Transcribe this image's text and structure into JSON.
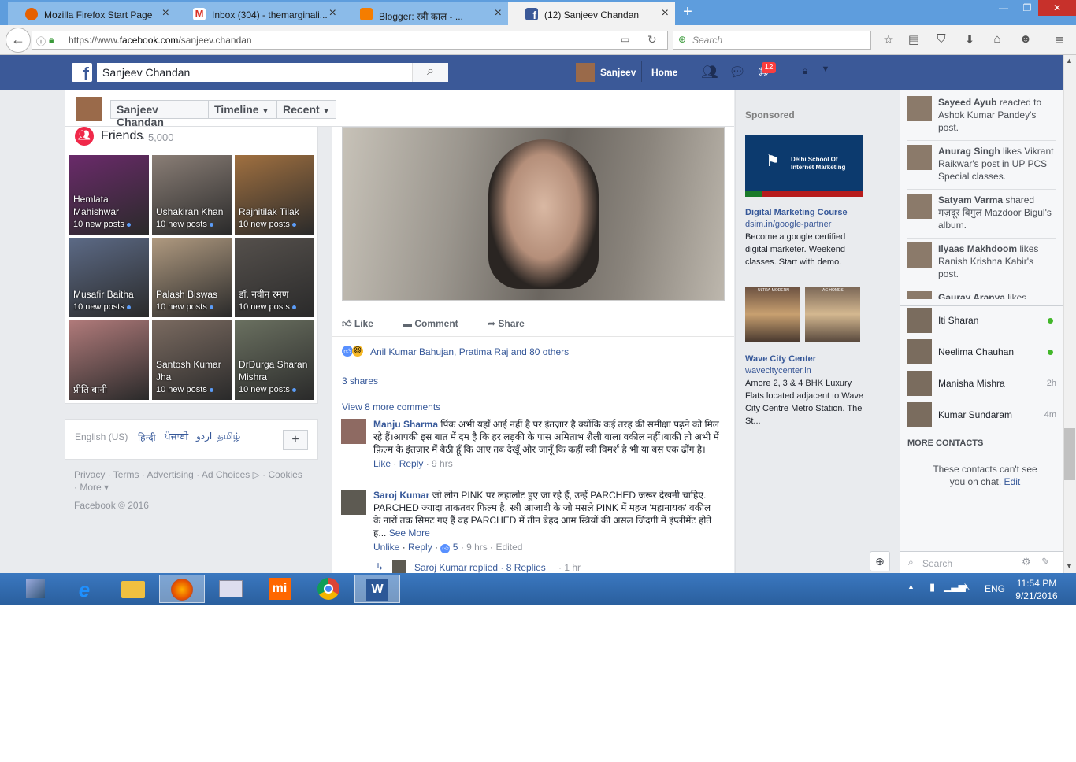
{
  "browser": {
    "tabs": [
      {
        "label": "Mozilla Firefox Start Page",
        "icon": "firefox-icon",
        "color": "#e66000"
      },
      {
        "label": "Inbox (304) - themarginali...",
        "icon": "gmail-icon",
        "color": "#d93025"
      },
      {
        "label": "Blogger: स्त्री काल - ...",
        "icon": "blogger-icon",
        "color": "#f57d00"
      },
      {
        "label": "(12) Sanjeev Chandan",
        "icon": "facebook-icon",
        "color": "#3b5998"
      }
    ],
    "url_prefix": "https://www.",
    "url_domain": "facebook.com",
    "url_path": "/sanjeev.chandan",
    "search_placeholder": "Search"
  },
  "fb": {
    "search_value": "Sanjeev Chandan",
    "user_name": "Sanjeev",
    "home_label": "Home",
    "notif_count": "12",
    "accent": "#3b5998"
  },
  "timeline_nav": {
    "name": "Sanjeev Chandan",
    "timeline": "Timeline",
    "recent": "Recent"
  },
  "friends": {
    "title": "Friends",
    "count": "5,000",
    "items": [
      {
        "name": "Hemlata Mahishwar",
        "posts": "10 new posts",
        "color": "#6a2a6a"
      },
      {
        "name": "Ushakiran Khan",
        "posts": "10 new posts",
        "color": "#8a7e76"
      },
      {
        "name": "Rajnitilak Tilak",
        "posts": "10 new posts",
        "color": "#a07040"
      },
      {
        "name": "Musafir Baitha",
        "posts": "10 new posts",
        "color": "#5c6a86"
      },
      {
        "name": "Palash Biswas",
        "posts": "10 new posts",
        "color": "#b09a80"
      },
      {
        "name": "डॉ. नवीन रमण",
        "posts": "10 new posts",
        "color": "#55504c"
      },
      {
        "name": "प्रीति बानी",
        "posts": "",
        "color": "#b07a7a"
      },
      {
        "name": "Santosh Kumar Jha",
        "posts": "10 new posts",
        "color": "#7a6a60"
      },
      {
        "name": "DrDurga Sharan Mishra",
        "posts": "10 new posts",
        "color": "#6a7060"
      }
    ]
  },
  "languages": {
    "items": [
      "English (US)",
      "हिन्दी",
      "ਪੰਜਾਬੀ",
      "اردو",
      "தமிழ்"
    ],
    "add": "+"
  },
  "footer": {
    "links": [
      "Privacy",
      "Terms",
      "Advertising",
      "Ad Choices",
      "Cookies",
      "More"
    ],
    "copyright": "Facebook © 2016"
  },
  "post": {
    "like": "Like",
    "comment": "Comment",
    "share": "Share",
    "reactions": "Anil Kumar Bahujan, Pratima Raj and 80 others",
    "shares": "3 shares",
    "view_more": "View 8 more comments",
    "comments": [
      {
        "author": "Manju Sharma",
        "text": "पिंक अभी यहाँ आई नहीं है पर इंतज़ार है क्योंकि कई तरह की समीक्षा पढ़ने को मिल रहे हैं।आपकी इस बात में दम है कि हर लड़की के पास अमिताभ शैली वाला वकील नहीं।बाकी तो अभी में फ़िल्म के इंतज़ार में बैठी हूँ कि आए तब देखूँ और जानूँ कि कहीं स्त्री विमर्श है भी या बस एक ढोंग है।",
        "like": "Like",
        "reply": "Reply",
        "time": "9 hrs"
      },
      {
        "author": "Saroj Kumar",
        "text": "जो लोग PINK पर लहालोट हुए जा रहे हैं, उन्हें PARCHED जरूर देखनी चाहिए. PARCHED ज्यादा ताकतवर फिल्म है. स्त्री आजादी के जो मसले PINK में महज 'महानायक' वकील के नारों तक सिमट गए हैं वह PARCHED में तीन बेहद आम स्त्रियों की असल जिंदगी में इंप्लीमेंट होते ह...",
        "see_more": "See More",
        "unlike": "Unlike",
        "reply": "Reply",
        "likes": "5",
        "time": "9 hrs",
        "edited": "Edited"
      }
    ],
    "replied": "Saroj Kumar replied · 8 Replies",
    "replied_time": "1 hr"
  },
  "ads": {
    "title": "Sponsored",
    "ad1": {
      "banner": "Delhi School Of Internet Marketing",
      "title": "Digital Marketing Course",
      "url": "dsim.in/google-partner",
      "text": "Become a google certified digital marketer. Weekend classes. Start with demo."
    },
    "ad2": {
      "img1": "ULTRA-MODERN",
      "img2": "AC HOMES",
      "title": "Wave City Center",
      "url": "wavecitycenter.in",
      "text": "Amore 2, 3 & 4 BHK Luxury Flats located adjacent to Wave City Centre Metro Station. The St..."
    }
  },
  "ticker": [
    {
      "actor": "Sayeed Ayub",
      "text": " reacted to Ashok Kumar Pandey's post."
    },
    {
      "actor": "Anurag Singh",
      "text": " likes Vikrant Raikwar's post in UP PCS Special classes."
    },
    {
      "actor": "Satyam Varma",
      "text": " shared मज़दूर बिगुल Mazdoor Bigul's album."
    },
    {
      "actor": "Ilyaas Makhdoom",
      "text": " likes Ranish Krishna Kabir's post."
    },
    {
      "actor": "Gaurav Aranya",
      "text": " likes"
    }
  ],
  "contacts": [
    {
      "name": "Iti Sharan",
      "status": "online"
    },
    {
      "name": "Neelima Chauhan",
      "status": "online"
    },
    {
      "name": "Manisha Mishra",
      "status": "2h"
    },
    {
      "name": "Kumar Sundaram",
      "status": "4m"
    }
  ],
  "chat": {
    "more": "MORE CONTACTS",
    "note": "These contacts can't see you on chat.",
    "edit": "Edit",
    "search": "Search"
  },
  "taskbar": {
    "lang": "ENG",
    "time": "11:54 PM",
    "date": "9/21/2016"
  }
}
